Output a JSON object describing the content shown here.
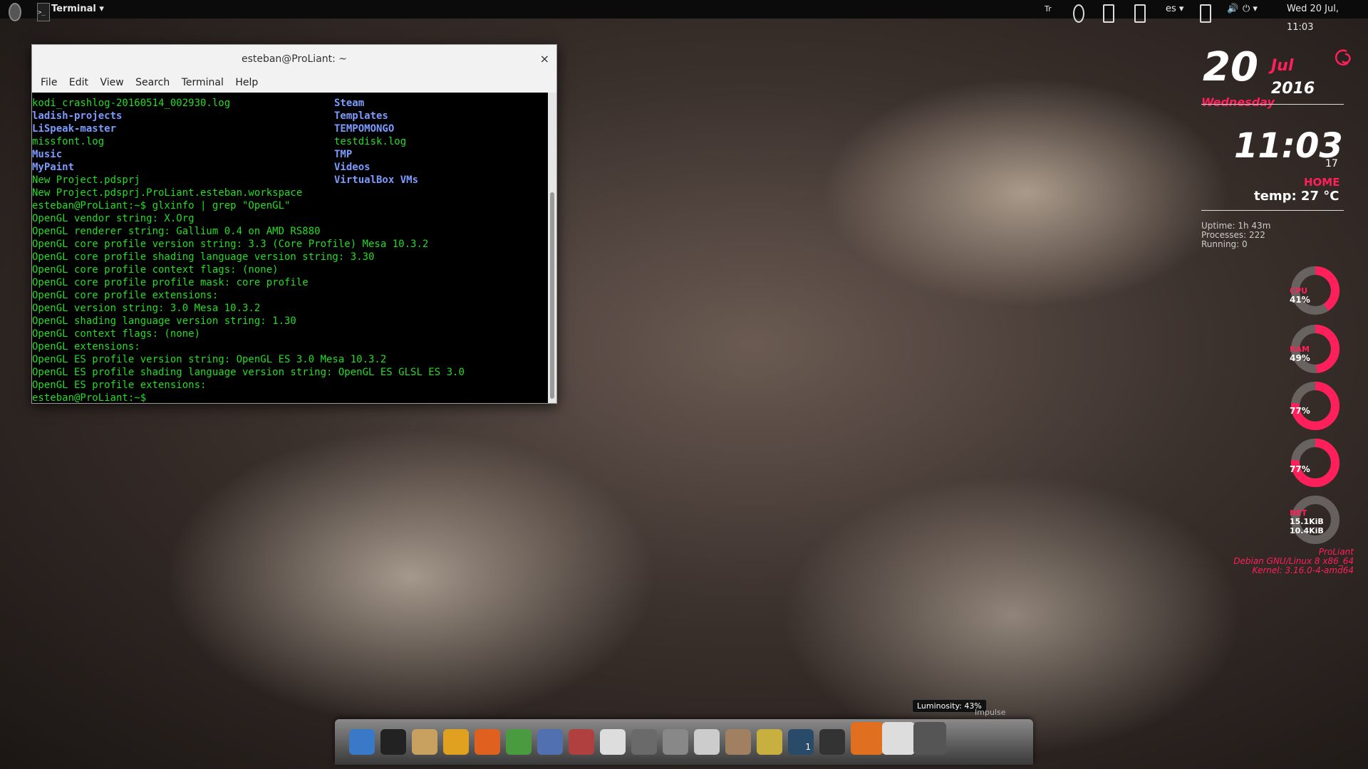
{
  "top_panel": {
    "app_menu": "Terminal ▾",
    "tray": {
      "tr": "Tr",
      "lang": "es ▾",
      "datetime": "Wed 20 Jul, 11:03"
    }
  },
  "terminal": {
    "title": "esteban@ProLiant: ~",
    "close_glyph": "×",
    "menu": [
      "File",
      "Edit",
      "View",
      "Search",
      "Terminal",
      "Help"
    ],
    "listing_left": [
      {
        "text": "kodi_crashlog-20160514_002930.log",
        "style": "g"
      },
      {
        "text": "ladish-projects",
        "style": "b"
      },
      {
        "text": "LiSpeak-master",
        "style": "b"
      },
      {
        "text": "missfont.log",
        "style": "g"
      },
      {
        "text": "Music",
        "style": "b"
      },
      {
        "text": "MyPaint",
        "style": "b"
      },
      {
        "text": "New Project.pdsprj",
        "style": "g"
      },
      {
        "text": "New Project.pdsprj.ProLiant.esteban.workspace",
        "style": "g"
      }
    ],
    "listing_right": [
      {
        "text": "Steam",
        "style": "b"
      },
      {
        "text": "Templates",
        "style": "b"
      },
      {
        "text": "TEMPOMONGO",
        "style": "b"
      },
      {
        "text": "testdisk.log",
        "style": "g"
      },
      {
        "text": "TMP",
        "style": "b"
      },
      {
        "text": "Videos",
        "style": "b"
      },
      {
        "text": "VirtualBox VMs",
        "style": "b"
      }
    ],
    "output": [
      "esteban@ProLiant:~$ glxinfo | grep \"OpenGL\"",
      "OpenGL vendor string: X.Org",
      "OpenGL renderer string: Gallium 0.4 on AMD RS880",
      "OpenGL core profile version string: 3.3 (Core Profile) Mesa 10.3.2",
      "OpenGL core profile shading language version string: 3.30",
      "OpenGL core profile context flags: (none)",
      "OpenGL core profile profile mask: core profile",
      "OpenGL core profile extensions:",
      "OpenGL version string: 3.0 Mesa 10.3.2",
      "OpenGL shading language version string: 1.30",
      "OpenGL context flags: (none)",
      "OpenGL extensions:",
      "OpenGL ES profile version string: OpenGL ES 3.0 Mesa 10.3.2",
      "OpenGL ES profile shading language version string: OpenGL ES GLSL ES 3.0",
      "OpenGL ES profile extensions:",
      "esteban@ProLiant:~$"
    ]
  },
  "conky": {
    "day": "20",
    "month": "Jul",
    "year": "2016",
    "weekday": "Wednesday",
    "time": "11:03",
    "seconds": "17",
    "home_label": "HOME",
    "temp": "temp: 27 °C",
    "uptime": "Uptime: 1h 43m",
    "processes": "Processes: 222",
    "running": "Running: 0",
    "cpu": {
      "label": "CPU",
      "value": "41%",
      "frac": 0.41
    },
    "ram": {
      "label": "RAM",
      "value": "49%",
      "frac": 0.49
    },
    "g3": {
      "value": "77%",
      "frac": 0.77
    },
    "g4": {
      "value": "77%",
      "frac": 0.77
    },
    "net": {
      "label": "NET",
      "down": "15.1KiB",
      "up": "10.4KiB"
    },
    "hostname": "ProLiant",
    "os": "Debian GNU/Linux 8 x86_64",
    "kernel": "Kernel: 3.16.0-4-amd64"
  },
  "dock": {
    "tooltip": "Luminosity: 43%",
    "impulse": "Impulse",
    "workspace": "1",
    "icons": [
      "accessibility-icon",
      "terminal-icon",
      "gimp-icon",
      "chrome-icon",
      "firefox-icon",
      "image-viewer-icon",
      "pidgin-icon",
      "software-center-icon",
      "document-viewer-icon",
      "calculator-icon",
      "text-editor-icon",
      "search-icon",
      "file-manager-icon",
      "folder-icon",
      "workspace-switcher-icon",
      "show-desktop-icon",
      "rss-icon",
      "brightness-icon",
      "audio-player-icon"
    ]
  },
  "colors": {
    "accent": "#ff1f5a",
    "term_green": "#22dd22",
    "term_blue": "#7b9cff"
  }
}
